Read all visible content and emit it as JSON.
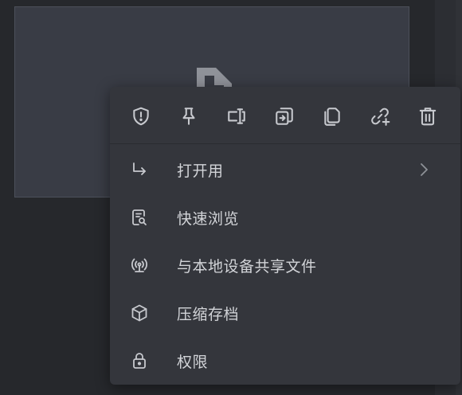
{
  "toolbar": {
    "buttons": [
      {
        "icon": "shield-alert-icon"
      },
      {
        "icon": "pin-icon"
      },
      {
        "icon": "rename-icon"
      },
      {
        "icon": "move-icon"
      },
      {
        "icon": "copy-icon"
      },
      {
        "icon": "link-add-icon"
      },
      {
        "icon": "trash-icon"
      }
    ]
  },
  "menu": {
    "items": [
      {
        "label": "打开用",
        "icon": "open-with-icon",
        "has_submenu": true
      },
      {
        "label": "快速浏览",
        "icon": "quick-look-icon",
        "has_submenu": false
      },
      {
        "label": "与本地设备共享文件",
        "icon": "share-local-icon",
        "has_submenu": false
      },
      {
        "label": "压缩存档",
        "icon": "archive-box-icon",
        "has_submenu": false
      },
      {
        "label": "权限",
        "icon": "lock-icon",
        "has_submenu": false
      }
    ]
  },
  "colors": {
    "background": "#26282c",
    "menu_bg": "#34363c",
    "card_bg": "#393c45",
    "text": "#d2d4d8",
    "icon": "#c7c9ce"
  }
}
